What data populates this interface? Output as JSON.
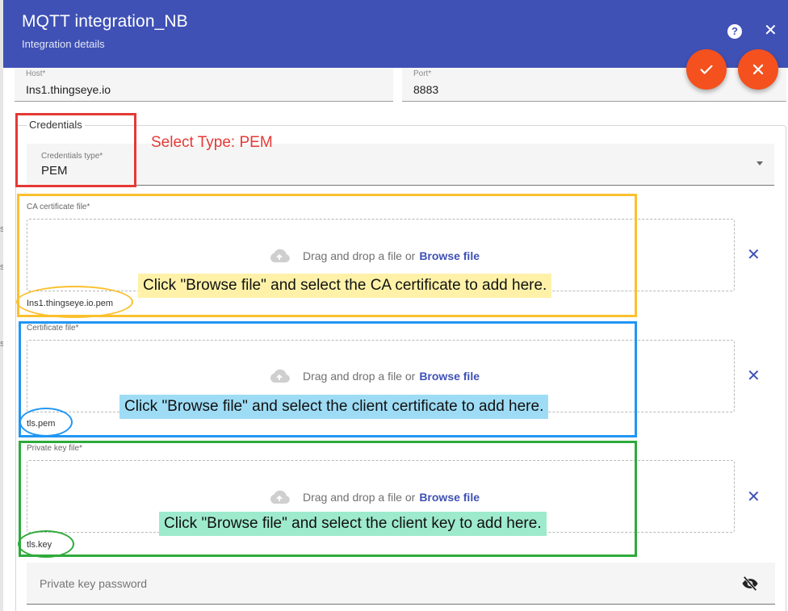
{
  "dialog": {
    "title": "MQTT integration_NB",
    "subtitle": "Integration details"
  },
  "header_actions": {
    "help_label": "?",
    "close_label": "✕"
  },
  "host": {
    "label": "Host*",
    "value": "Ins1.thingseye.io"
  },
  "port": {
    "label": "Port*",
    "value": "8883"
  },
  "credentials": {
    "legend": "Credentials",
    "type_label": "Credentials type*",
    "type_value": "PEM"
  },
  "files": [
    {
      "label": "CA certificate file*",
      "drop_text": "Drag and drop a file or",
      "browse_label": "Browse file",
      "file_name": "Ins1.thingseye.io.pem"
    },
    {
      "label": "Certificate file*",
      "drop_text": "Drag and drop a file or",
      "browse_label": "Browse file",
      "file_name": "tls.pem"
    },
    {
      "label": "Private key file*",
      "drop_text": "Drag and drop a file or",
      "browse_label": "Browse file",
      "file_name": "tls.key"
    }
  ],
  "remove_label": "✕",
  "password": {
    "placeholder": "Private key password"
  },
  "annotations": {
    "type_note": "Select Type: PEM",
    "ca_note": "Click \"Browse file\" and select the CA certificate to add here.",
    "cert_note": "Click \"Browse file\" and select the client certificate to add here.",
    "key_note": "Click \"Browse file\" and select the client key to add here."
  },
  "background_letters": [
    "s",
    "s",
    "s"
  ],
  "colors": {
    "header": "#3f51b5",
    "accent": "#f4511e",
    "link": "#3f51b5",
    "annotation_red": "#e53935",
    "annotation_yellow": "#fbc02d",
    "annotation_blue": "#2196f3",
    "annotation_green": "#2eaa3a"
  },
  "icons": {
    "help": "help-circle-icon",
    "close": "close-icon",
    "confirm": "check-icon",
    "cancel": "cancel-icon",
    "upload": "cloud-upload-icon",
    "remove": "remove-file-icon",
    "visibility": "eye-off-icon",
    "dropdown": "dropdown-arrow-icon"
  }
}
